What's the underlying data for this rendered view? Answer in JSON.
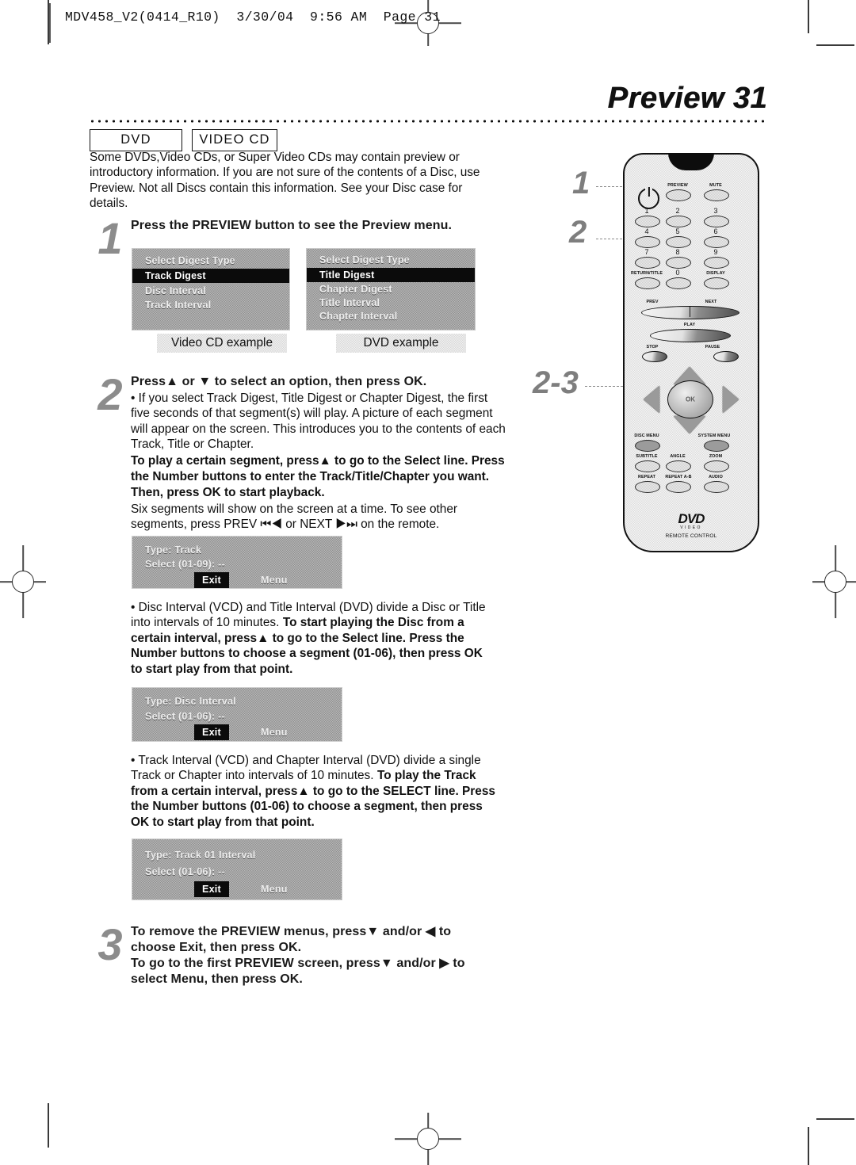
{
  "scan_header": "MDV458_V2(0414_R10)  3/30/04  9:56 AM  Page 31",
  "page_title": "Preview  31",
  "badges": [
    {
      "label": "DVD"
    },
    {
      "label": "VIDEO CD"
    }
  ],
  "intro": "Some DVDs,Video CDs, or Super Video CDs may contain preview or introductory information. If you are not sure of the contents of a Disc, use Preview. Not all Discs contain this information. See your Disc case for details.",
  "steps": [
    {
      "number": "1",
      "heading": "Press the PREVIEW  button to see the Preview menu."
    },
    {
      "number": "2",
      "heading": "Press▲ or ▼ to select an option, then press OK.",
      "para1": "• If you select Track Digest, Title Digest or Chapter Digest,  the first five seconds of that segment(s) will play. A picture of each segment will appear on the screen. This introduces you to the contents of each Track, Title or Chapter.",
      "para2_bold": "To play a certain segment, press▲ to go to the Select line. Press the Number buttons to enter the Track/Title/Chapter you want. Then, press OK to start playback.",
      "para3": "Six segments will show on the screen at a time. To see other segments, press PREV ⏮◀ or NEXT ▶⏭ on the remote.",
      "bullet2_normal_a": "• Disc Interval (VCD) and Title Interval (DVD) divide a Disc or Title into intervals of 10 minutes.",
      "bullet2_bold": "To start playing the Disc from a certain interval, press▲ to go to the Select line. Press the Number buttons to choose a segment (01-06), then press OK to start play from that point.",
      "bullet3_normal_a": "• Track Interval (VCD) and Chapter Interval (DVD) divide a single Track or Chapter into intervals of 10 minutes.",
      "bullet3_bold": "To play the Track from a certain interval, press▲ to go to the  SELECT line. Press the Number buttons (01-06) to choose a segment, then press OK to start play from that point."
    },
    {
      "number": "3",
      "heading_line1": "To remove the PREVIEW  menus, press▼ and/or ◀ to",
      "heading_line2": "choose Exit, then press OK.",
      "heading_line3": "To go to the first PREVIEW  screen, press▼ and/or ▶ to",
      "heading_line4": "select Menu, then press OK."
    }
  ],
  "menus": {
    "vcd": {
      "caption": "Video CD example",
      "items": [
        {
          "label": "Select Digest Type",
          "selected": false
        },
        {
          "label": "Track Digest",
          "selected": true
        },
        {
          "label": "Disc Interval",
          "selected": false
        },
        {
          "label": "Track Interval",
          "selected": false
        }
      ]
    },
    "dvd": {
      "caption": "DVD example",
      "items": [
        {
          "label": "Select Digest Type",
          "selected": false
        },
        {
          "label": "Title Digest",
          "selected": true
        },
        {
          "label": "Chapter Digest",
          "selected": false
        },
        {
          "label": "Title Interval",
          "selected": false
        },
        {
          "label": "Chapter Interval",
          "selected": false
        }
      ]
    }
  },
  "osd_boxes": [
    {
      "type_line": "Type: Track",
      "select_line": "Select (01-09): --",
      "exit_label": "Exit",
      "menu_label": "Menu"
    },
    {
      "type_line": "Type: Disc Interval",
      "select_line": "Select (01-06): --",
      "exit_label": "Exit",
      "menu_label": "Menu"
    },
    {
      "type_line": "Type: Track 01 Interval",
      "select_line": "Select (01-06): --",
      "exit_label": "Exit",
      "menu_label": "Menu"
    }
  ],
  "remote": {
    "callouts": [
      {
        "label": "1"
      },
      {
        "label": "2"
      },
      {
        "label": "2-3"
      }
    ],
    "buttons": {
      "preview": "PREVIEW",
      "mute": "MUTE",
      "n1": "1",
      "n2": "2",
      "n3": "3",
      "n4": "4",
      "n5": "5",
      "n6": "6",
      "n7": "7",
      "n8": "8",
      "n9": "9",
      "return_title": "RETURN/TITLE",
      "n0": "0",
      "display": "DISPLAY",
      "prev": "PREV",
      "next": "NEXT",
      "play": "PLAY",
      "stop": "STOP",
      "pause": "PAUSE",
      "ok": "OK",
      "disc_menu": "DISC MENU",
      "system_menu": "SYSTEM MENU",
      "subtitle": "SUBTITLE",
      "angle": "ANGLE",
      "zoom": "ZOOM",
      "repeat": "REPEAT",
      "repeat_ab": "REPEAT A-B",
      "audio": "AUDIO"
    },
    "logo_main": "DVD",
    "logo_sub": "VIDEO",
    "logo_caption": "REMOTE CONTROL"
  },
  "colors": {
    "ink": "#111111",
    "step_number": "#8c8c8c",
    "osd_bg": "#a8a8a8",
    "osd_selected": "#0b0b0b"
  }
}
